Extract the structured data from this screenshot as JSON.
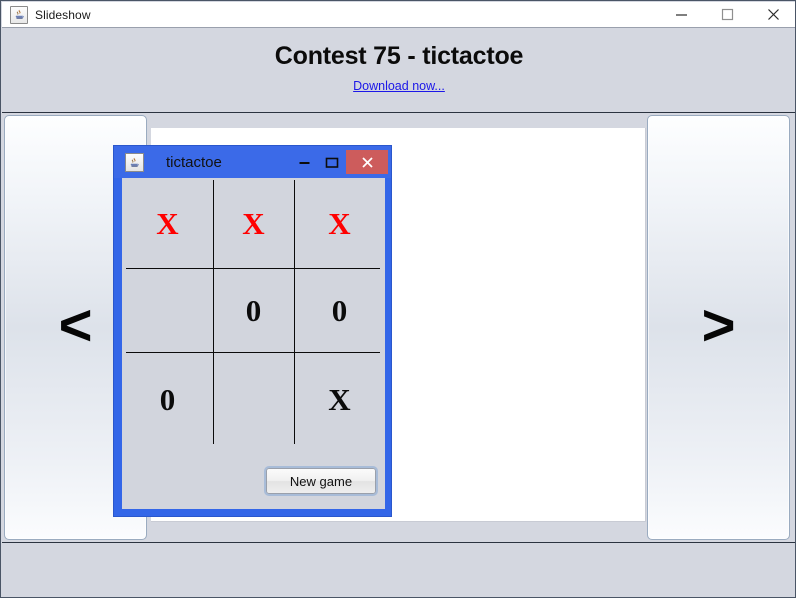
{
  "window": {
    "title": "Slideshow",
    "icon": "java-coffee-cup-icon",
    "controls": {
      "minimize": "minimize-icon",
      "maximize": "maximize-icon",
      "close": "close-icon"
    }
  },
  "header": {
    "title": "Contest 75 - tictactoe",
    "link_label": "Download now..."
  },
  "nav": {
    "prev_label": "<",
    "next_label": ">"
  },
  "inner_window": {
    "title": "tictactoe",
    "icon": "java-coffee-cup-icon",
    "controls": {
      "minimize": "minimize-icon",
      "maximize": "maximize-icon",
      "close": "close-icon"
    },
    "board": {
      "cells": [
        {
          "mark": "X",
          "color": "#ff0000"
        },
        {
          "mark": "X",
          "color": "#ff0000"
        },
        {
          "mark": "X",
          "color": "#ff0000"
        },
        {
          "mark": "",
          "color": ""
        },
        {
          "mark": "0",
          "color": "#0b0b0b"
        },
        {
          "mark": "0",
          "color": "#0b0b0b"
        },
        {
          "mark": "0",
          "color": "#0b0b0b"
        },
        {
          "mark": "",
          "color": ""
        },
        {
          "mark": "X",
          "color": "#0b0b0b"
        }
      ]
    },
    "new_game_label": "New game"
  },
  "colors": {
    "panel_bg": "#d4d7e0",
    "inner_window_frame": "#3366e8",
    "inner_close_button": "#cd5c5c",
    "link": "#1c17e8",
    "x_red": "#ff0000",
    "mark_black": "#0b0b0b"
  }
}
